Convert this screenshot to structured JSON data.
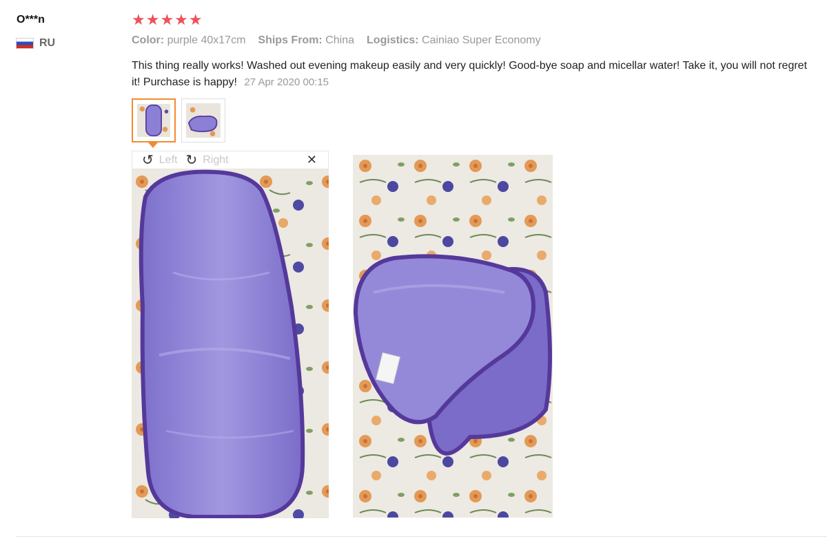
{
  "reviewer": {
    "name": "O***n",
    "country_code": "RU"
  },
  "rating": {
    "stars": 5,
    "display": "★★★★★",
    "color": "#f0505a"
  },
  "attributes": [
    {
      "key": "Color:",
      "value": "purple 40x17cm"
    },
    {
      "key": "Ships From:",
      "value": "China"
    },
    {
      "key": "Logistics:",
      "value": "Cainiao Super Economy"
    }
  ],
  "review": {
    "text": "This thing really works! Washed out evening makeup easily and very quickly! Good-bye soap and micellar water! Take it, you will not regret it! Purchase is happy!",
    "date": "27 Apr 2020 00:15"
  },
  "viewer": {
    "rotate_left_label": "Left",
    "rotate_right_label": "Right",
    "close_glyph": "✕",
    "rotate_left_glyph": "↺",
    "rotate_right_glyph": "↻"
  },
  "colors": {
    "accent_border": "#f28a33",
    "towel_purple": "#8c7fd6",
    "towel_edge": "#5b3f9e"
  }
}
